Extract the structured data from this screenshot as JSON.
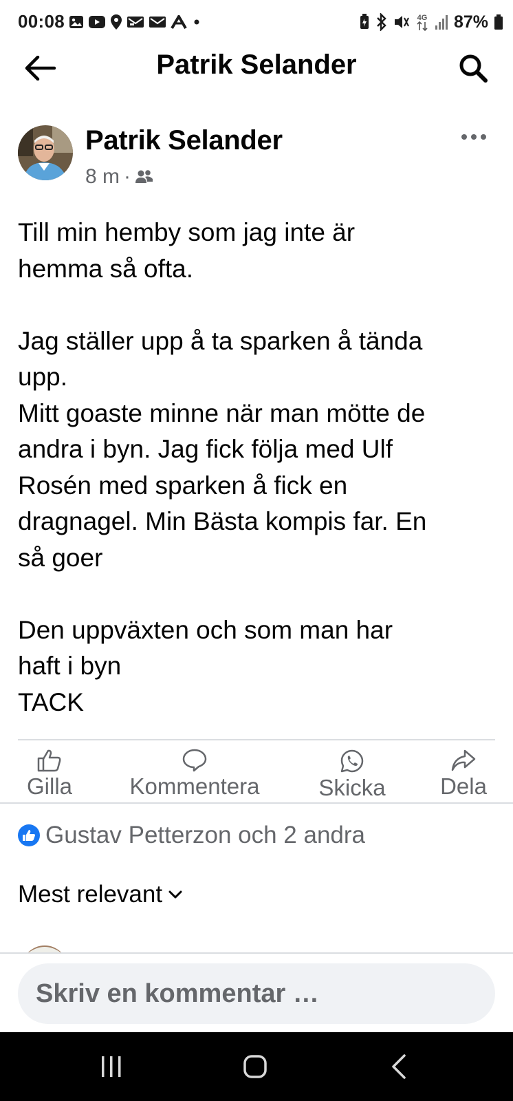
{
  "status_bar": {
    "time": "00:08",
    "battery": "87%",
    "network": "4G",
    "left_icons": [
      "gallery-icon",
      "youtube-icon",
      "location-icon",
      "mail-icon",
      "mail-icon",
      "app-icon",
      "dot-icon"
    ],
    "right_icons": [
      "battery-saver-icon",
      "bluetooth-icon",
      "mute-icon",
      "network-4g-icon",
      "signal-icon",
      "battery-icon"
    ]
  },
  "header": {
    "title": "Patrik Selander",
    "back_icon": "arrow-left-icon",
    "search_icon": "search-icon"
  },
  "post": {
    "author": "Patrik Selander",
    "time": "8 m",
    "separator": "·",
    "audience_icon": "friends-icon",
    "more_icon": "ellipsis-icon",
    "body_lines": [
      "Till min hemby som jag inte är",
      "hemma så ofta.",
      "",
      "Jag ställer upp å ta sparken å tända",
      "upp.",
      "Mitt goaste minne när man mötte de",
      "andra i byn. Jag fick följa med Ulf",
      "Rosén med sparken å fick en",
      "dragnagel.  Min Bästa kompis far. En",
      "så goer",
      "",
      "Den uppväxten och som man har",
      "haft i byn",
      "TACK"
    ]
  },
  "actions": {
    "like": "Gilla",
    "comment": "Kommentera",
    "send": "Skicka",
    "share": "Dela"
  },
  "reactions": {
    "text": "Gustav Petterzon och 2 andra",
    "icon": "like-badge-icon"
  },
  "comments": {
    "sort_label": "Mest relevant",
    "sort_icon": "chevron-down-icon"
  },
  "composer": {
    "placeholder": "Skriv en kommentar …"
  },
  "nav_bar": {
    "items": [
      "recents-icon",
      "home-icon",
      "back-icon"
    ]
  },
  "colors": {
    "text_primary": "#050505",
    "text_secondary": "#65676b",
    "brand_blue": "#1877f2",
    "divider": "#dadde1",
    "input_bg": "#f0f2f5",
    "nav_bg": "#000000"
  }
}
